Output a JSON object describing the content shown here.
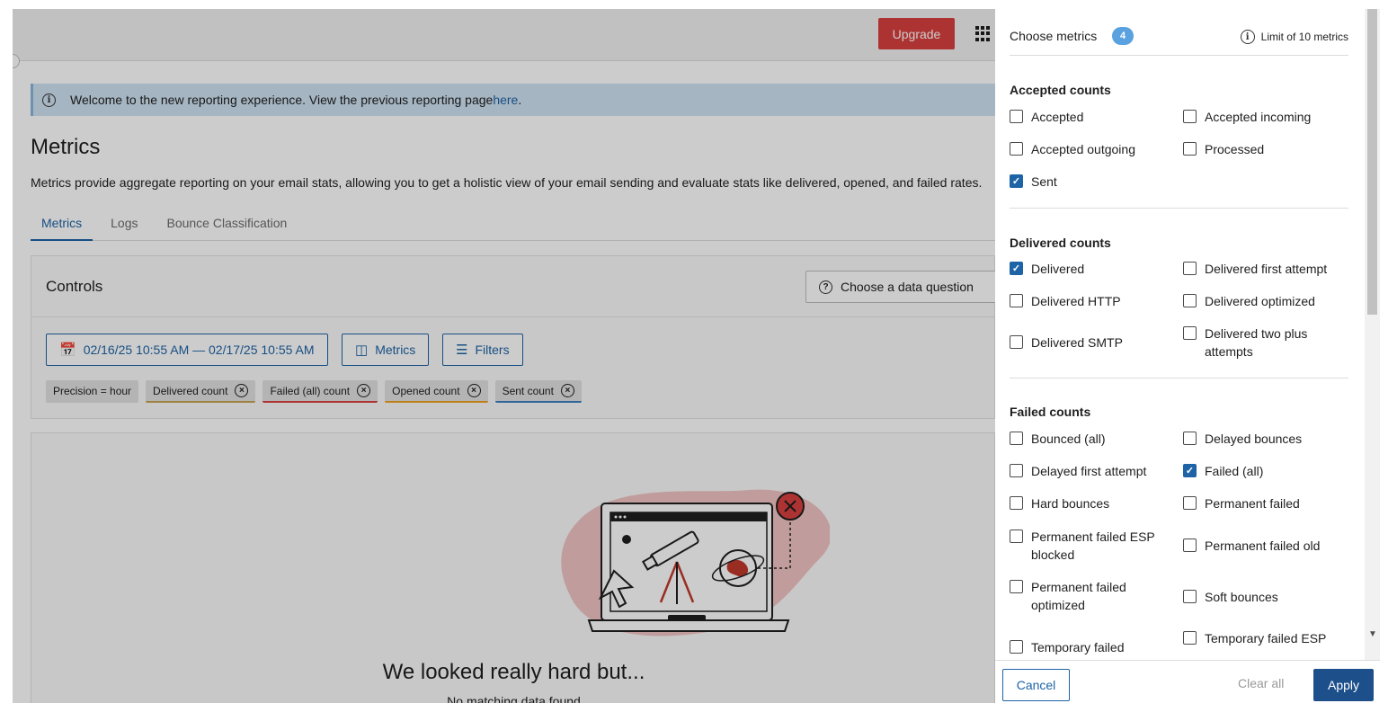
{
  "topbar": {
    "upgrade_label": "Upgrade"
  },
  "banner": {
    "text": "Welcome to the new reporting experience. View the previous reporting page ",
    "link": "here",
    "suffix": "."
  },
  "page": {
    "title": "Metrics",
    "description": "Metrics provide aggregate reporting on your email stats, allowing you to get a holistic view of your email sending and evaluate stats like delivered, opened, and failed rates."
  },
  "tabs": [
    "Metrics",
    "Logs",
    "Bounce Classification"
  ],
  "controls": {
    "title": "Controls",
    "data_question": "Choose a data question",
    "date_range": "02/16/25 10:55 AM — 02/17/25 10:55 AM",
    "metrics_label": "Metrics",
    "filters_label": "Filters",
    "chips": [
      {
        "label": "Precision = hour",
        "removable": false,
        "accent": ""
      },
      {
        "label": "Delivered count",
        "removable": true,
        "accent": "#c9a34f"
      },
      {
        "label": "Failed (all) count",
        "removable": true,
        "accent": "#d9403f"
      },
      {
        "label": "Opened count",
        "removable": true,
        "accent": "#f0a020"
      },
      {
        "label": "Sent count",
        "removable": true,
        "accent": "#3d7fc1"
      }
    ]
  },
  "empty_state": {
    "title": "We looked really hard but...",
    "subtitle": "No matching data found"
  },
  "drawer": {
    "title": "Choose metrics",
    "count": "4",
    "limit": "Limit of 10 metrics",
    "groups": {
      "accepted": {
        "title": "Accepted counts",
        "items": [
          "Accepted",
          "Accepted incoming",
          "Accepted outgoing",
          "Processed",
          "Sent"
        ]
      },
      "delivered": {
        "title": "Delivered counts",
        "items": [
          "Delivered",
          "Delivered first attempt",
          "Delivered HTTP",
          "Delivered optimized",
          "Delivered SMTP",
          "Delivered two plus attempts"
        ]
      },
      "failed": {
        "title": "Failed counts",
        "items": [
          "Bounced (all)",
          "Delayed bounces",
          "Delayed first attempt",
          "Failed (all)",
          "Hard bounces",
          "Permanent failed",
          "Permanent failed ESP blocked",
          "Permanent failed old",
          "Permanent failed optimized",
          "Soft bounces",
          "Temporary failed",
          "Temporary failed ESP"
        ]
      }
    },
    "checked": [
      "Sent",
      "Delivered",
      "Failed (all)"
    ],
    "footer": {
      "cancel": "Cancel",
      "clear": "Clear all",
      "apply": "Apply"
    }
  },
  "colors": {
    "accent": "#1d63a6",
    "upgrade": "#d9403f",
    "apply": "#1d4f8b",
    "badge": "#5aa1e0"
  }
}
